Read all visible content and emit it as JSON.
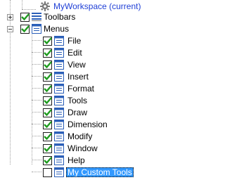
{
  "tree": {
    "workspace_label": "MyWorkspace (current)",
    "toolbars_label": "Toolbars",
    "menus_label": "Menus",
    "menu_items": [
      {
        "label": "File",
        "checked": true
      },
      {
        "label": "Edit",
        "checked": true
      },
      {
        "label": "View",
        "checked": true
      },
      {
        "label": "Insert",
        "checked": true
      },
      {
        "label": "Format",
        "checked": true
      },
      {
        "label": "Tools",
        "checked": true
      },
      {
        "label": "Draw",
        "checked": true
      },
      {
        "label": "Dimension",
        "checked": true
      },
      {
        "label": "Modify",
        "checked": true
      },
      {
        "label": "Window",
        "checked": true
      },
      {
        "label": "Help",
        "checked": true
      },
      {
        "label": "My Custom Tools",
        "checked": false,
        "selected": true
      }
    ]
  },
  "colors": {
    "selection": "#3399ff",
    "link": "#1f3fd6",
    "check": "#1f9b1f"
  }
}
